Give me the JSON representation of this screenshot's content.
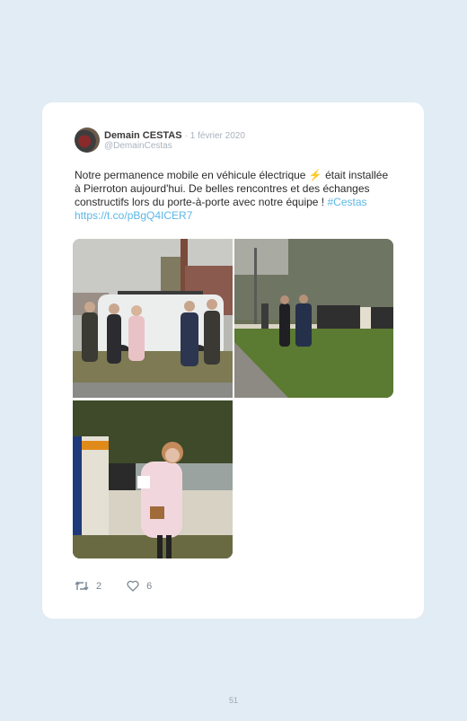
{
  "tweet": {
    "author_name": "Demain CESTAS",
    "date": "· 1 février 2020",
    "handle": "@DemainCestas",
    "text_part1": "Notre permanence mobile en véhicule électrique ",
    "bolt": "⚡",
    "text_part2": " était installée à Pierroton aujourd'hui. De belles rencontres et des échanges constructifs lors du porte-à-porte avec notre équipe ! ",
    "hashtag": "#Cestas",
    "link": "https://t.co/pBgQ4ICER7",
    "retweets": "2",
    "likes": "6"
  },
  "page_number": "51",
  "icons": {
    "avatar": "avatar",
    "retweet": "retweet-icon",
    "like": "heart-icon"
  },
  "colors": {
    "background": "#e1ecf4",
    "card": "#ffffff",
    "link": "#5cb7e6",
    "muted": "#a9b3bd"
  }
}
